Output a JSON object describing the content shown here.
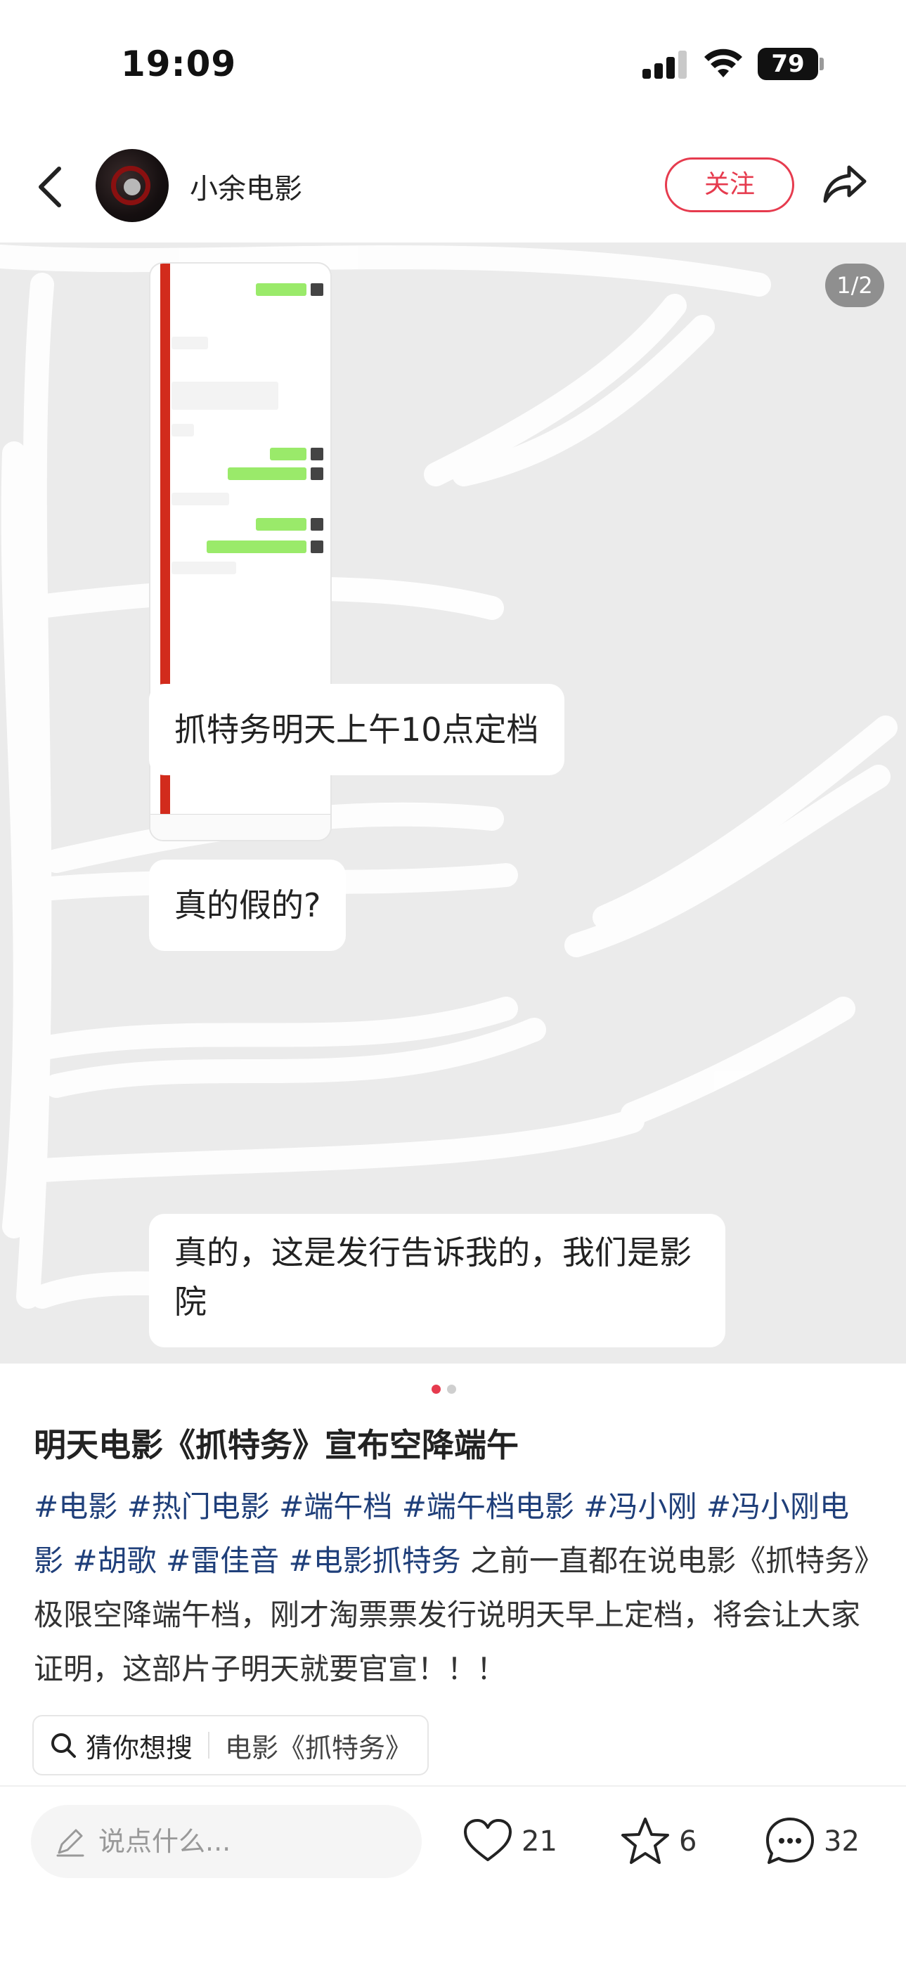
{
  "status_bar": {
    "time": "19:09",
    "battery": "79"
  },
  "header": {
    "author": "小余电影",
    "follow_label": "关注"
  },
  "image": {
    "counter": "1/2",
    "bubbles": [
      "抓特务明天上午10点定档",
      "真的假的?",
      "真的，这是发行告诉我的，我们是影院"
    ],
    "current_page": 1,
    "total_pages": 2
  },
  "post": {
    "title": "明天电影《抓特务》宣布空降端午",
    "tags": [
      "#电影",
      "#热门电影",
      "#端午档",
      "#端午档电影",
      "#冯小刚",
      "#冯小刚电影",
      "#胡歌",
      "#雷佳音",
      "#电影抓特务"
    ],
    "body": "之前一直都在说电影《抓特务》极限空降端午档，刚才淘票票发行说明天早上定档，将会让大家证明，这部片子明天就要官宣！！！"
  },
  "guess_search": {
    "label": "猜你想搜",
    "query": "电影《抓特务》"
  },
  "bottom_bar": {
    "comment_placeholder": "说点什么...",
    "likes": "21",
    "stars": "6",
    "comments": "32"
  },
  "colors": {
    "accent": "#e63b4e",
    "tag": "#1f3f7a"
  }
}
